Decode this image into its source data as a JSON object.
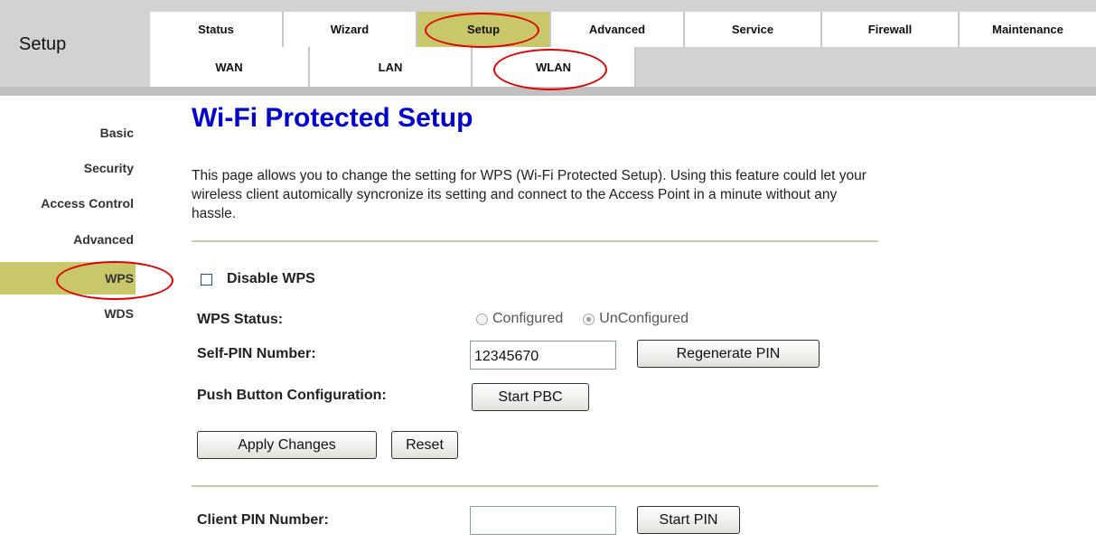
{
  "header": {
    "brand": "Setup",
    "main_tabs": [
      {
        "label": "Status"
      },
      {
        "label": "Wizard"
      },
      {
        "label": "Setup"
      },
      {
        "label": "Advanced"
      },
      {
        "label": "Service"
      },
      {
        "label": "Firewall"
      },
      {
        "label": "Maintenance"
      }
    ],
    "sub_tabs": [
      {
        "label": "WAN"
      },
      {
        "label": "LAN"
      },
      {
        "label": "WLAN"
      }
    ]
  },
  "sidebar": {
    "items": [
      {
        "label": "Basic"
      },
      {
        "label": "Security"
      },
      {
        "label": "Access Control"
      },
      {
        "label": "Advanced"
      },
      {
        "label": "WPS"
      },
      {
        "label": "WDS"
      }
    ],
    "active": "WPS"
  },
  "main": {
    "title": "Wi-Fi Protected Setup",
    "description": "This page allows you to change the setting for WPS (Wi-Fi Protected Setup). Using this feature could let your wireless client automically syncronize its setting and connect to the Access Point in a minute without any hassle.",
    "disable_wps_label": "Disable WPS",
    "disable_wps_checked": false,
    "wps_status_label": "WPS Status:",
    "wps_status_options": [
      "Configured",
      "UnConfigured"
    ],
    "wps_status_selected": "UnConfigured",
    "self_pin_label": "Self-PIN Number:",
    "self_pin_value": "12345670",
    "regenerate_pin_label": "Regenerate PIN",
    "pbc_label": "Push Button Configuration:",
    "start_pbc_label": "Start PBC",
    "apply_label": "Apply Changes",
    "reset_label": "Reset",
    "client_pin_label": "Client PIN Number:",
    "client_pin_value": "",
    "start_pin_label": "Start PIN"
  },
  "colors": {
    "active_tab": "#c8c86a",
    "header_bg": "#d2d2d2",
    "title": "#0000cc",
    "annotation": "#e00000"
  }
}
